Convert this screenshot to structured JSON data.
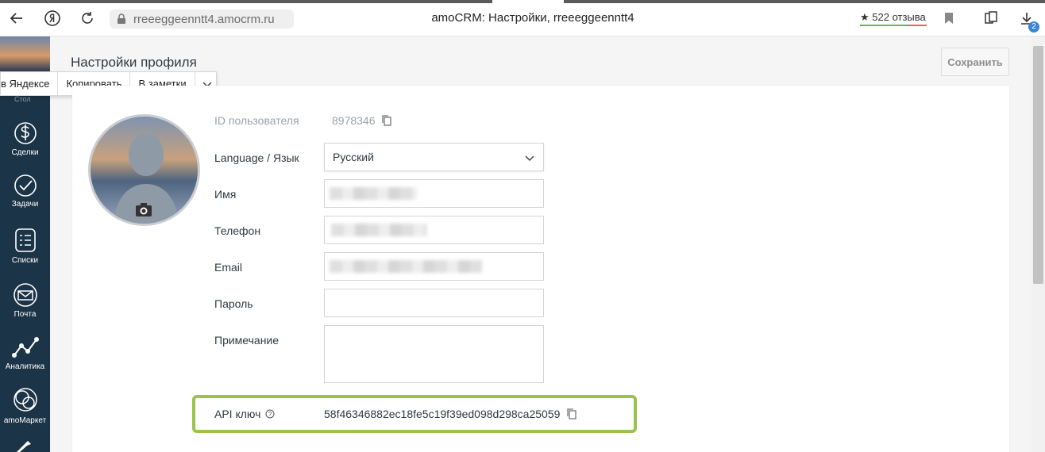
{
  "browser": {
    "url": "rreeeggeenntt4.amocrm.ru",
    "page_title": "amoCRM: Настройки, rreeeggeenntt4",
    "rating": "★ 522 отзыва",
    "downloads_badge": "2"
  },
  "selection_popup": {
    "items": [
      "в Яндексе",
      "Копировать",
      "В заметки"
    ]
  },
  "sidebar": {
    "partial_label": "Стол",
    "items": [
      {
        "label": "Сделки",
        "icon": "dollar-icon"
      },
      {
        "label": "Задачи",
        "icon": "check-circle-icon"
      },
      {
        "label": "Списки",
        "icon": "list-icon"
      },
      {
        "label": "Почта",
        "icon": "mail-icon"
      },
      {
        "label": "Аналитика",
        "icon": "analytics-icon"
      },
      {
        "label": "amoМаркет",
        "icon": "market-icon"
      }
    ]
  },
  "profile": {
    "heading": "Настройки профиля",
    "save_label": "Сохранить",
    "user_id_label": "ID пользователя",
    "user_id": "8978346",
    "language_label": "Language / Язык",
    "language_value": "Русский",
    "name_label": "Имя",
    "phone_label": "Телефон",
    "email_label": "Email",
    "password_label": "Пароль",
    "note_label": "Примечание",
    "api_label": "API ключ",
    "api_key": "58f46346882ec18fe5c19f39ed098d298ca25059"
  },
  "colors": {
    "sidebar_bg": "#1c3447",
    "highlight_border": "#9bc24a"
  }
}
